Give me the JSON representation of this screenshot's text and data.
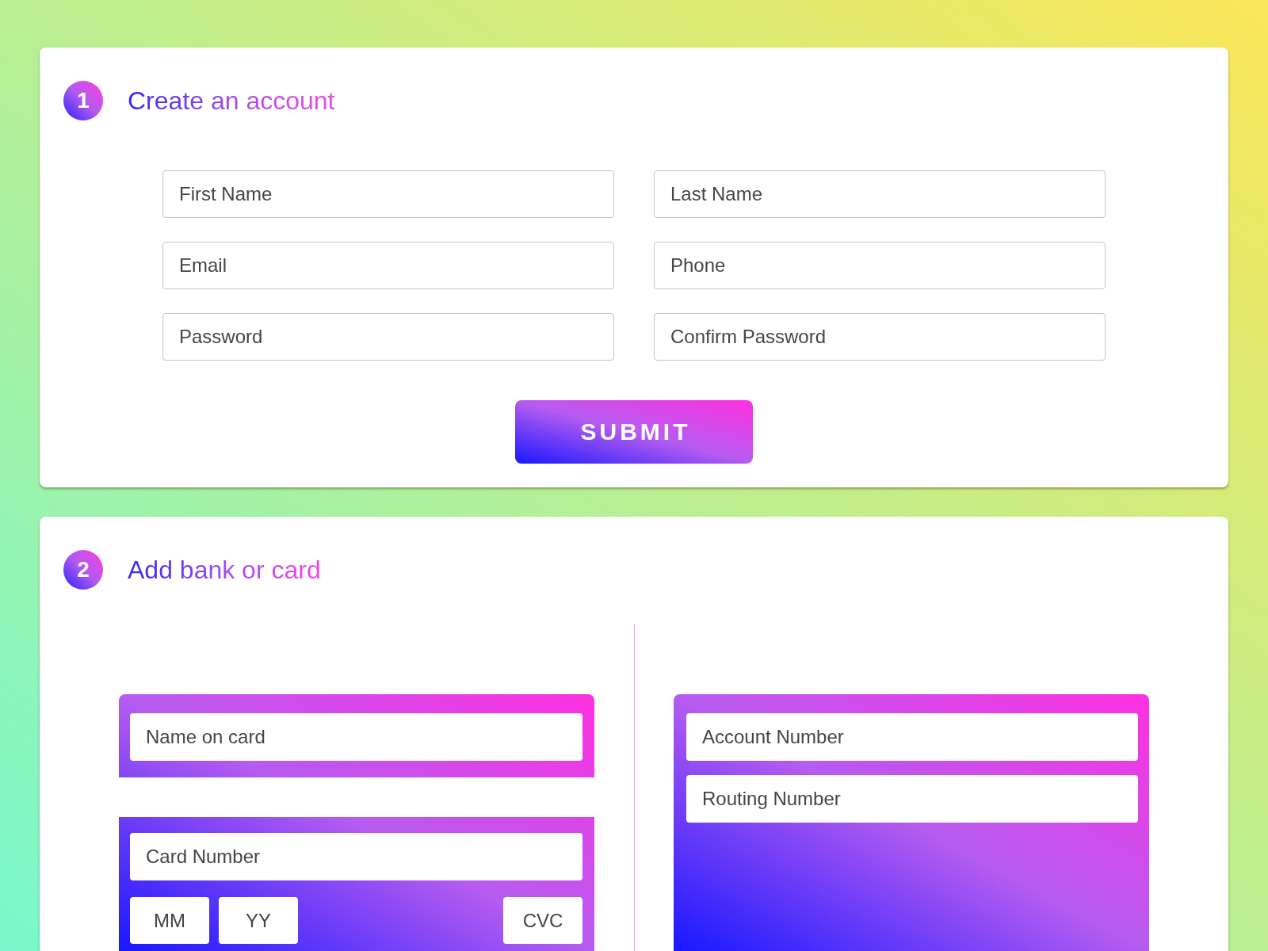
{
  "account_section": {
    "step": "1",
    "title": "Create an account",
    "fields": [
      {
        "placeholder": "First Name"
      },
      {
        "placeholder": "Last Name"
      },
      {
        "placeholder": "Email"
      },
      {
        "placeholder": "Phone"
      },
      {
        "placeholder": "Password"
      },
      {
        "placeholder": "Confirm Password"
      }
    ],
    "submit_button": "SUBMIT"
  },
  "payment_section": {
    "step": "2",
    "title": "Add bank or card",
    "card_form": {
      "name_field": {
        "placeholder": "Name on card"
      },
      "number_field": {
        "placeholder": "Card Number"
      },
      "month_field": {
        "placeholder": "MM"
      },
      "year_field": {
        "placeholder": "YY"
      },
      "cvc_field": {
        "placeholder": "CVC"
      }
    },
    "bank_form": {
      "fields": [
        {
          "placeholder": "Account Number"
        },
        {
          "placeholder": "Routing Number"
        }
      ]
    }
  }
}
